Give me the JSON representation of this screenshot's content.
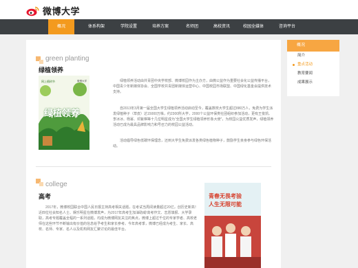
{
  "brand": {
    "title": "微博大学",
    "logo_icon": "weibo-logo-icon"
  },
  "nav": {
    "items": [
      {
        "label": "概况",
        "active": true
      },
      {
        "label": "体系构架",
        "active": false
      },
      {
        "label": "学院设置",
        "active": false
      },
      {
        "label": "培养方案",
        "active": false
      },
      {
        "label": "名师团",
        "active": false
      },
      {
        "label": "高校资讯",
        "active": false
      },
      {
        "label": "校园全媒体",
        "active": false
      },
      {
        "label": "咨询平台",
        "active": false
      }
    ]
  },
  "sidebar": {
    "header": "概况",
    "links": [
      {
        "label": "简介",
        "active": false
      },
      {
        "label": "重点活动",
        "active": true
      },
      {
        "label": "教育要闻",
        "active": false
      },
      {
        "label": "成果展示",
        "active": false
      }
    ]
  },
  "sections": [
    {
      "en": "green planting",
      "zh": "绿植领养",
      "poster_text": {
        "top": "网上植树节",
        "title": "绿植领养",
        "sub": "微博大学"
      },
      "paragraphs": [
        "绿植领养活动由共青团中央学校部、微博校园作为主办方，由微公益作为重要社会化公益传播平台，中国青少年新媒体协会、全国学校共青团新媒体运营中心、中国校园市场联盟、中国绿化基金会提供技术支持。",
        "自2013年3月第一届全国大学生绿植领养活动启动至今，覆盖数校大学生超过880万人，免费为学生派发绿植种子（草皮）达15000万株，约2300所大学，2000个公益环保类社团组织参加活动，更有王俊凯、李冰冰、杨幂、邓紫棋等十几位明星成为“全国大学生绿植领养形象大使”，为校园公益优质发声，绿植领养活动已成为最具品牌影响力和号召力的校园公益活动。",
        "活动倡导绿色低碳环保理念，还到大学生免费派发各类绿色植物种子，鼓励学生亲身参与绿色环保活动。"
      ]
    },
    {
      "en": "college",
      "zh": "高考",
      "poster_text": {
        "line1": "青春无畏考验",
        "line2": "人生无限可能"
      },
      "paragraphs": [
        "2017年，微博校园联合中国人民日报主持高考相关话题，在考试当周阅读量超过20亿，创历史新高！近四位社会知名人士、娱乐明星在微博发声，为2017年高考生加油助威!高考作文、志愿填报、大学录取，高考专题覆盖全程的一系列话题，均成为微博网友关注的焦点，微博上超过千位的专家学者、高校老师在这些环节不断输出有价值的信息给予考生和家长参考。今年高考季，微博已经成为考生、家长、高校、名师、专家、名人以及机构网友汇聚讨论的最佳平台。"
      ]
    }
  ],
  "colors": {
    "accent": "#f39a1e",
    "nav_bg": "#3c4043",
    "sidebar_head": "#f7a642"
  }
}
